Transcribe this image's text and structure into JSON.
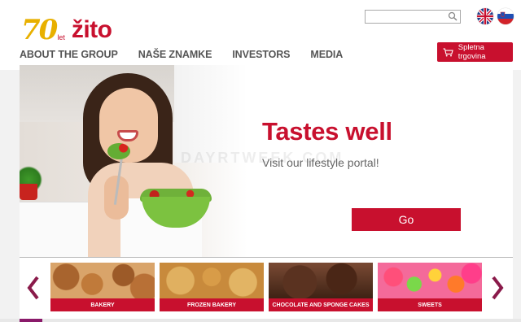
{
  "brand": {
    "anniversary": "70",
    "anniversary_suffix": "let",
    "name": "žito",
    "colors": {
      "primary": "#c8102e",
      "gold": "#e8b000"
    }
  },
  "header": {
    "search": {
      "placeholder": "",
      "icon": "search-icon"
    },
    "languages": [
      {
        "code": "en",
        "icon": "uk-flag-icon"
      },
      {
        "code": "sl",
        "icon": "slovenia-flag-icon"
      }
    ],
    "shop_button": {
      "label": "Spletna trgovina",
      "icon": "cart-icon"
    }
  },
  "nav": {
    "items": [
      {
        "label": "ABOUT THE GROUP"
      },
      {
        "label": "NAŠE ZNAMKE"
      },
      {
        "label": "INVESTORS"
      },
      {
        "label": "MEDIA"
      }
    ]
  },
  "hero": {
    "headline": "Tastes well",
    "subline": "Visit our lifestyle portal!",
    "button": "Go",
    "watermark": "DAYRTWEEK.COM"
  },
  "categories": {
    "prev_icon": "chevron-left-icon",
    "next_icon": "chevron-right-icon",
    "items": [
      {
        "label": "BAKERY"
      },
      {
        "label": "FROZEN BAKERY"
      },
      {
        "label": "CHOCOLATE AND SPONGE CAKES"
      },
      {
        "label": "SWEETS"
      }
    ]
  }
}
